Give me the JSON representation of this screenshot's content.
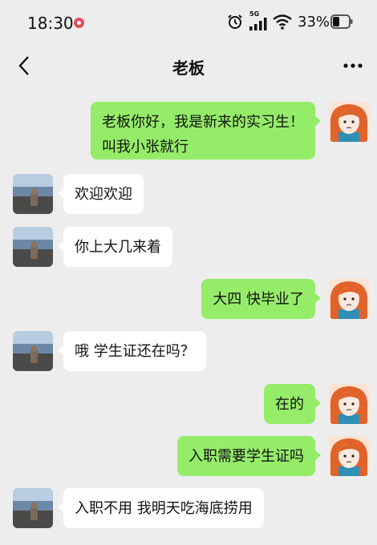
{
  "status_bar": {
    "time": "18:30",
    "network": "5G",
    "battery": "33%",
    "icons": [
      "recording-icon",
      "alarm-icon",
      "signal-icon",
      "wifi-icon",
      "battery-icon"
    ]
  },
  "header": {
    "title": "老板",
    "back_icon": "chevron-left-icon",
    "more_icon": "more-dots-icon"
  },
  "colors": {
    "background": "#ededed",
    "incoming_bubble": "#ffffff",
    "outgoing_bubble": "#95ec69",
    "record_dot": "#e84b5a"
  },
  "messages": [
    {
      "sender": "me",
      "lines": [
        "老板你好，我是新来的实习生！",
        "叫我小张就行"
      ]
    },
    {
      "sender": "boss",
      "lines": [
        "欢迎欢迎"
      ]
    },
    {
      "sender": "boss",
      "lines": [
        "你上大几来着"
      ]
    },
    {
      "sender": "me",
      "lines": [
        "大四 快毕业了"
      ]
    },
    {
      "sender": "boss",
      "lines": [
        "哦 学生证还在吗？"
      ]
    },
    {
      "sender": "me",
      "lines": [
        "在的"
      ]
    },
    {
      "sender": "me",
      "lines": [
        "入职需要学生证吗"
      ]
    },
    {
      "sender": "boss",
      "lines": [
        "入职不用 我明天吃海底捞用"
      ]
    }
  ]
}
